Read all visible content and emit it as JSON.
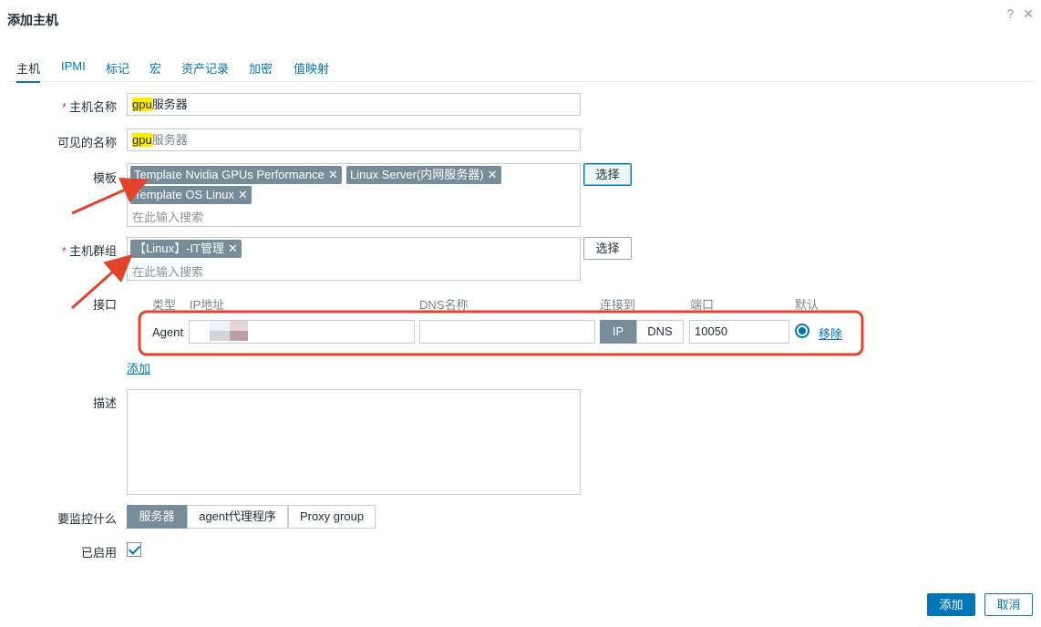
{
  "dialog": {
    "title": "添加主机",
    "help_glyph": "?",
    "close_glyph": "✕"
  },
  "tabs": [
    {
      "label": "主机",
      "active": true
    },
    {
      "label": "IPMI"
    },
    {
      "label": "标记"
    },
    {
      "label": "宏"
    },
    {
      "label": "资产记录"
    },
    {
      "label": "加密"
    },
    {
      "label": "值映射"
    }
  ],
  "form": {
    "host_name": {
      "label": "主机名称",
      "required": true,
      "value_highlight": "gpu",
      "value_rest": "服务器"
    },
    "visible_name": {
      "label": "可见的名称",
      "value_highlight": "gpu",
      "value_rest": "服务器"
    },
    "templates": {
      "label": "模板",
      "items": [
        "Template Nvidia GPUs Performance",
        "Linux Server(内网服务器)",
        "Template OS Linux"
      ],
      "remove_glyph": "✕",
      "placeholder": "在此输入搜索",
      "select_label": "选择"
    },
    "host_groups": {
      "label": "主机群组",
      "required": true,
      "items": [
        "【Linux】-IT管理"
      ],
      "remove_glyph": "✕",
      "placeholder": "在此输入搜索",
      "select_label": "选择"
    },
    "interfaces": {
      "label": "接口",
      "columns": {
        "type": "类型",
        "ip": "IP地址",
        "dns": "DNS名称",
        "connect": "连接到",
        "port": "端口",
        "default": "默认"
      },
      "row": {
        "type": "Agent",
        "ip": "",
        "dns": "",
        "connect_ip": "IP",
        "connect_dns": "DNS",
        "port": "10050",
        "remove": "移除"
      },
      "add_label": "添加"
    },
    "description": {
      "label": "描述",
      "value": ""
    },
    "monitored_by": {
      "label": "要监控什么",
      "options": [
        "服务器",
        "agent代理程序",
        "Proxy group"
      ],
      "selected": "服务器"
    },
    "enabled": {
      "label": "已启用",
      "checked": true
    }
  },
  "footer": {
    "add_label": "添加",
    "cancel_label": "取消"
  },
  "colors": {
    "accent": "#0275b8",
    "chip": "#768d99",
    "annotation": "#e0442c"
  }
}
